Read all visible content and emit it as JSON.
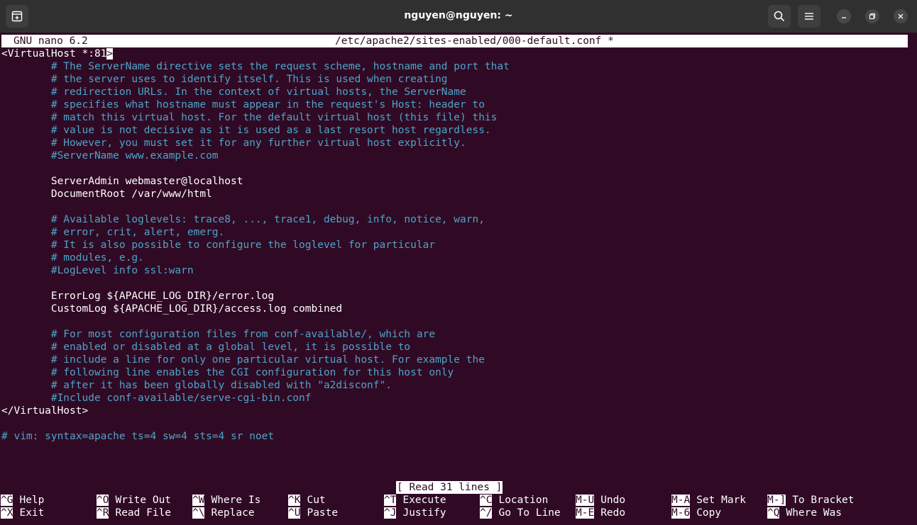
{
  "window": {
    "title": "nguyen@nguyen: ~"
  },
  "nano": {
    "version": "GNU nano 6.2",
    "filename": "/etc/apache2/sites-enabled/000-default.conf *"
  },
  "editor": {
    "cursor_char": ">",
    "lines": [
      {
        "text": "<VirtualHost *:81",
        "type": "code"
      },
      {
        "text": "        # The ServerName directive sets the request scheme, hostname and port that",
        "type": "comment"
      },
      {
        "text": "        # the server uses to identify itself. This is used when creating",
        "type": "comment"
      },
      {
        "text": "        # redirection URLs. In the context of virtual hosts, the ServerName",
        "type": "comment"
      },
      {
        "text": "        # specifies what hostname must appear in the request's Host: header to",
        "type": "comment"
      },
      {
        "text": "        # match this virtual host. For the default virtual host (this file) this",
        "type": "comment"
      },
      {
        "text": "        # value is not decisive as it is used as a last resort host regardless.",
        "type": "comment"
      },
      {
        "text": "        # However, you must set it for any further virtual host explicitly.",
        "type": "comment"
      },
      {
        "text": "        #ServerName www.example.com",
        "type": "comment"
      },
      {
        "text": "",
        "type": "code"
      },
      {
        "text": "        ServerAdmin webmaster@localhost",
        "type": "code"
      },
      {
        "text": "        DocumentRoot /var/www/html",
        "type": "code"
      },
      {
        "text": "",
        "type": "code"
      },
      {
        "text": "        # Available loglevels: trace8, ..., trace1, debug, info, notice, warn,",
        "type": "comment"
      },
      {
        "text": "        # error, crit, alert, emerg.",
        "type": "comment"
      },
      {
        "text": "        # It is also possible to configure the loglevel for particular",
        "type": "comment"
      },
      {
        "text": "        # modules, e.g.",
        "type": "comment"
      },
      {
        "text": "        #LogLevel info ssl:warn",
        "type": "comment"
      },
      {
        "text": "",
        "type": "code"
      },
      {
        "text": "        ErrorLog ${APACHE_LOG_DIR}/error.log",
        "type": "code"
      },
      {
        "text": "        CustomLog ${APACHE_LOG_DIR}/access.log combined",
        "type": "code"
      },
      {
        "text": "",
        "type": "code"
      },
      {
        "text": "        # For most configuration files from conf-available/, which are",
        "type": "comment"
      },
      {
        "text": "        # enabled or disabled at a global level, it is possible to",
        "type": "comment"
      },
      {
        "text": "        # include a line for only one particular virtual host. For example the",
        "type": "comment"
      },
      {
        "text": "        # following line enables the CGI configuration for this host only",
        "type": "comment"
      },
      {
        "text": "        # after it has been globally disabled with \"a2disconf\".",
        "type": "comment"
      },
      {
        "text": "        #Include conf-available/serve-cgi-bin.conf",
        "type": "comment"
      },
      {
        "text": "</VirtualHost>",
        "type": "code"
      },
      {
        "text": "",
        "type": "code"
      },
      {
        "text": "# vim: syntax=apache ts=4 sw=4 sts=4 sr noet",
        "type": "comment"
      }
    ]
  },
  "status": {
    "message": "[ Read 31 lines ]"
  },
  "shortcuts": [
    [
      {
        "key": "^G",
        "label": "Help"
      },
      {
        "key": "^O",
        "label": "Write Out"
      },
      {
        "key": "^W",
        "label": "Where Is"
      },
      {
        "key": "^K",
        "label": "Cut"
      },
      {
        "key": "^T",
        "label": "Execute"
      },
      {
        "key": "^C",
        "label": "Location"
      },
      {
        "key": "M-U",
        "label": "Undo"
      },
      {
        "key": "M-A",
        "label": "Set Mark"
      },
      {
        "key": "M-]",
        "label": "To Bracket"
      }
    ],
    [
      {
        "key": "^X",
        "label": "Exit"
      },
      {
        "key": "^R",
        "label": "Read File"
      },
      {
        "key": "^\\",
        "label": "Replace"
      },
      {
        "key": "^U",
        "label": "Paste"
      },
      {
        "key": "^J",
        "label": "Justify"
      },
      {
        "key": "^/",
        "label": "Go To Line"
      },
      {
        "key": "M-E",
        "label": "Redo"
      },
      {
        "key": "M-6",
        "label": "Copy"
      },
      {
        "key": "^Q",
        "label": "Where Was"
      }
    ]
  ],
  "icons": {
    "new_tab": "new-tab-icon",
    "search": "search-icon",
    "menu": "hamburger-menu-icon",
    "minimize": "minimize-icon",
    "maximize": "maximize-icon",
    "close": "close-icon"
  },
  "colors": {
    "terminal_bg": "#300a24",
    "titlebar_bg": "#303030",
    "comment": "#4ea3c8",
    "text": "#ffffff"
  }
}
